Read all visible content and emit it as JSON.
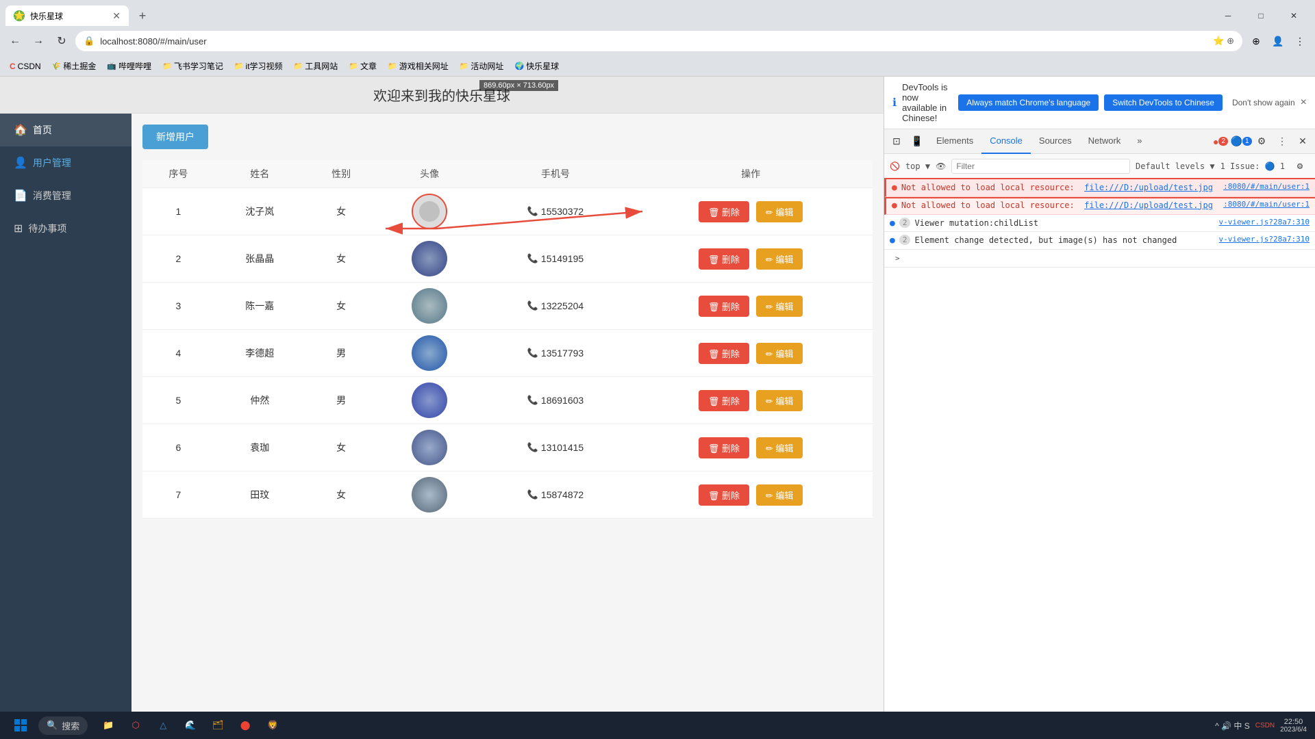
{
  "browser": {
    "tab_title": "快乐星球",
    "url": "localhost:8080/#/main/user",
    "favicon": "🌟",
    "new_tab_label": "+",
    "nav": {
      "back": "←",
      "forward": "→",
      "refresh": "↻"
    },
    "bookmarks": [
      {
        "label": "CSDN",
        "icon": "C"
      },
      {
        "label": "稀土掘金",
        "icon": "📄"
      },
      {
        "label": "哔哩哔哩",
        "icon": "📺"
      },
      {
        "label": "飞书学习笔记",
        "icon": "📁"
      },
      {
        "label": "it学习视频",
        "icon": "📁"
      },
      {
        "label": "工具网站",
        "icon": "📁"
      },
      {
        "label": "文章",
        "icon": "📁"
      },
      {
        "label": "游戏相关网址",
        "icon": "📁"
      },
      {
        "label": "活动网址",
        "icon": "📁"
      },
      {
        "label": "快乐星球",
        "icon": "🌍"
      }
    ]
  },
  "dimension_indicator": "869.60px × 713.60px",
  "page": {
    "title": "欢迎来到我的快乐星球",
    "add_user_btn": "新增用户",
    "columns": [
      "序号",
      "姓名",
      "性别",
      "头像",
      "手机号",
      "操作"
    ],
    "users": [
      {
        "id": 1,
        "name": "沈子岚",
        "gender": "女",
        "phone": "15530372",
        "avatar": "placeholder"
      },
      {
        "id": 2,
        "name": "张晶晶",
        "gender": "女",
        "phone": "15149195",
        "avatar": "av2"
      },
      {
        "id": 3,
        "name": "陈一嘉",
        "gender": "女",
        "phone": "13225204",
        "avatar": "av3"
      },
      {
        "id": 4,
        "name": "李德超",
        "gender": "男",
        "phone": "13517793",
        "avatar": "av4"
      },
      {
        "id": 5,
        "name": "仲然",
        "gender": "男",
        "phone": "18691603",
        "avatar": "av5"
      },
      {
        "id": 6,
        "name": "袁珈",
        "gender": "女",
        "phone": "13101415",
        "avatar": "av6"
      },
      {
        "id": 7,
        "name": "田玟",
        "gender": "女",
        "phone": "15874872",
        "avatar": "av7"
      }
    ],
    "delete_btn": "🗑 删除",
    "edit_btn": "✏ 编辑"
  },
  "sidebar": {
    "items": [
      {
        "label": "首页",
        "icon": "🏠",
        "active": true
      },
      {
        "label": "用户管理",
        "icon": "👤",
        "active": false
      },
      {
        "label": "消费管理",
        "icon": "📄",
        "active": false
      },
      {
        "label": "待办事项",
        "icon": "⊞",
        "active": false
      }
    ]
  },
  "devtools": {
    "notification": {
      "text": "DevTools is now available in Chinese!",
      "btn1": "Always match Chrome's language",
      "btn2": "Switch DevTools to Chinese",
      "link": "Don't show again",
      "close": "×"
    },
    "tabs": [
      "Elements",
      "Console",
      "Sources",
      "Network"
    ],
    "active_tab": "Console",
    "badges": {
      "errors": "2",
      "issues": "1"
    },
    "filter_placeholder": "Filter",
    "default_levels": "Default levels ▼",
    "issue_label": "1 Issue: 🔵 1",
    "top_context": "top ▼",
    "console_messages": [
      {
        "type": "error",
        "selected": true,
        "message": "Not allowed to load local resource: ",
        "link": "file:///D:/upload/test.jpg",
        "source": ":8080/#/main/user:1",
        "count": null
      },
      {
        "type": "error",
        "selected": false,
        "message": "Not allowed to load local resource: ",
        "link": "file:///D:/upload/test.jpg",
        "source": ":8080/#/main/user:1",
        "count": null
      },
      {
        "type": "info",
        "count": "2",
        "message": "Viewer mutation:childList",
        "source": "v-viewer.js?28a7:310"
      },
      {
        "type": "info",
        "count": "2",
        "message": "Element change detected, but image(s) has not changed",
        "source": "v-viewer.js?28a7:310"
      }
    ],
    "arrow_btn": ">"
  },
  "taskbar": {
    "search_placeholder": "搜索",
    "time": "22:50",
    "date": "2023/6/...",
    "system_tray": "中 S"
  }
}
